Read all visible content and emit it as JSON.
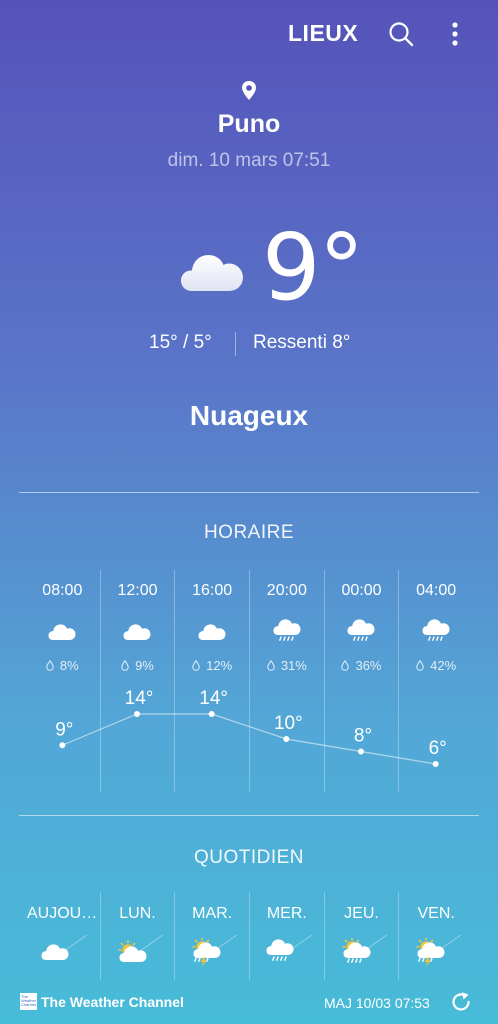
{
  "header": {
    "places_label": "LIEUX",
    "search_icon": "search-icon",
    "more_icon": "more-vertical-icon"
  },
  "location": {
    "pin_icon": "location-pin-icon",
    "city": "Puno",
    "datetime": "dim. 10 mars 07:51"
  },
  "current": {
    "icon": "cloud-icon",
    "temperature": "9°",
    "hi_lo": "15° / 5°",
    "feels_like": "Ressenti 8°",
    "condition": "Nuageux"
  },
  "hourly": {
    "title": "HORAIRE",
    "items": [
      {
        "time": "08:00",
        "icon": "cloud-icon",
        "precip": "8%",
        "temp": "9°",
        "temp_value": 9
      },
      {
        "time": "12:00",
        "icon": "cloud-icon",
        "precip": "9%",
        "temp": "14°",
        "temp_value": 14
      },
      {
        "time": "16:00",
        "icon": "cloud-icon",
        "precip": "12%",
        "temp": "14°",
        "temp_value": 14
      },
      {
        "time": "20:00",
        "icon": "rain-cloud-icon",
        "precip": "31%",
        "temp": "10°",
        "temp_value": 10
      },
      {
        "time": "00:00",
        "icon": "rain-cloud-icon",
        "precip": "36%",
        "temp": "8°",
        "temp_value": 8
      },
      {
        "time": "04:00",
        "icon": "rain-cloud-icon",
        "precip": "42%",
        "temp": "6°",
        "temp_value": 6
      }
    ]
  },
  "daily": {
    "title": "QUOTIDIEN",
    "items": [
      {
        "day": "AUJOURD'HUI",
        "icon": "cloud-icon"
      },
      {
        "day": "LUN.",
        "icon": "partly-cloudy-icon"
      },
      {
        "day": "MAR.",
        "icon": "sun-storm-icon"
      },
      {
        "day": "MER.",
        "icon": "rain-cloud-icon"
      },
      {
        "day": "JEU.",
        "icon": "sun-rain-icon"
      },
      {
        "day": "VEN.",
        "icon": "sun-storm-icon"
      }
    ]
  },
  "footer": {
    "brand": "The Weather Channel",
    "logo_text": "The Weather Channel",
    "updated": "MAJ  10/03  07:53",
    "refresh_icon": "refresh-icon"
  },
  "colors": {
    "gradient_top": "#5553b9",
    "gradient_bottom": "#47bcd8",
    "text": "#ffffff"
  }
}
